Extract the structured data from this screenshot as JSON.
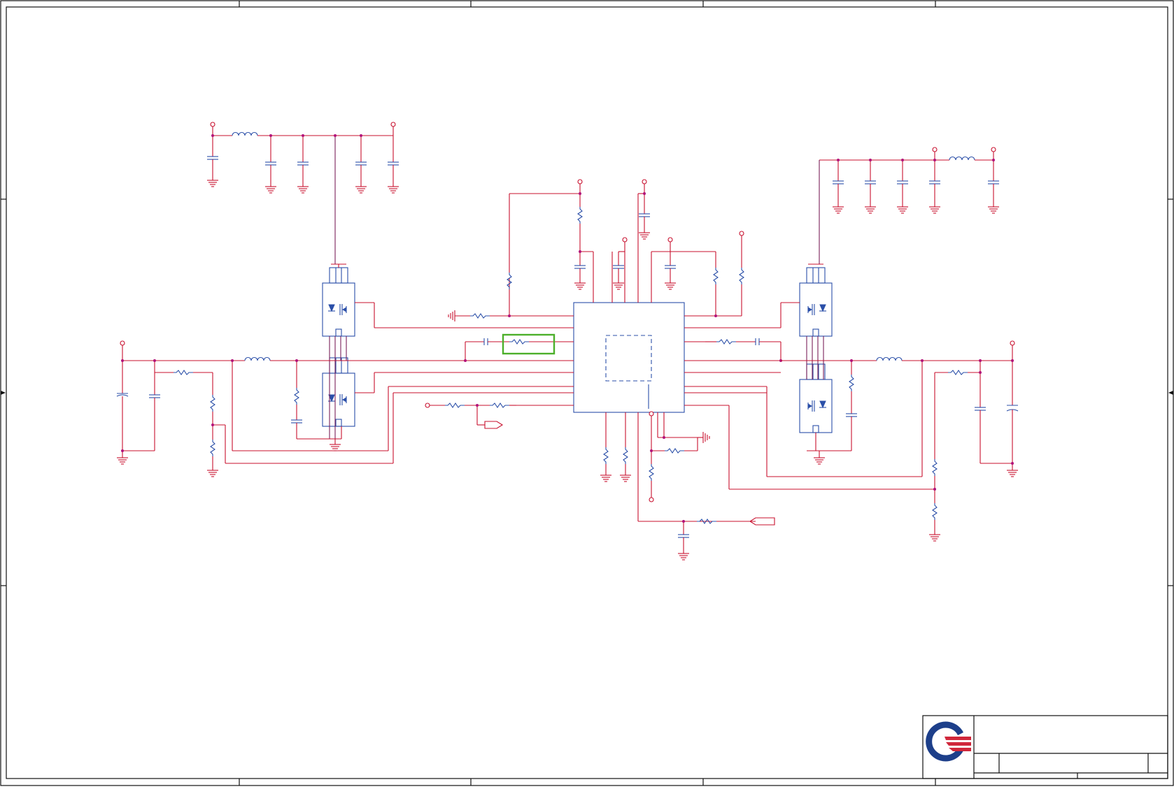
{
  "sheet": {
    "title_block": {
      "logo": "company-logo",
      "fields": [
        "",
        "",
        "",
        "",
        ""
      ]
    },
    "highlight_color": "#4caf2a",
    "wire_color": "#c8102e",
    "component_color": "#2b4fa8",
    "frame_color": "#111111"
  }
}
